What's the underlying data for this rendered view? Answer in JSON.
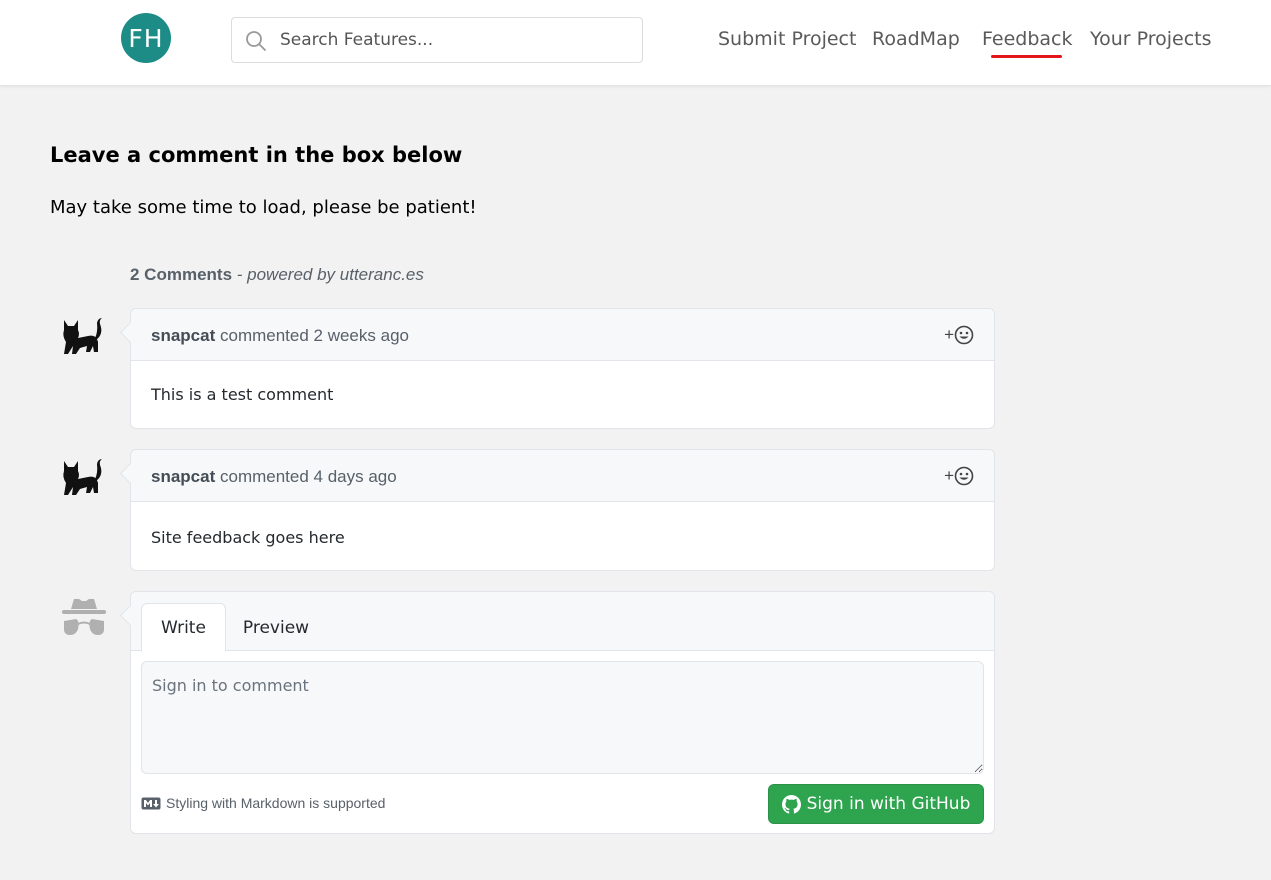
{
  "header": {
    "logo_text": "FH",
    "search_placeholder": "Search Features...",
    "nav": [
      {
        "label": "Submit Project"
      },
      {
        "label": "RoadMap"
      },
      {
        "label": "Feedback",
        "active": true
      },
      {
        "label": "Your Projects"
      }
    ]
  },
  "main": {
    "heading": "Leave a comment in the box below",
    "subtext": "May take some time to load, please be patient!"
  },
  "comments_widget": {
    "count_label": "2 Comments",
    "powered_by": "- powered by utteranc.es",
    "comments": [
      {
        "author": "snapcat",
        "meta": "commented 2 weeks ago",
        "body": "This is a test comment",
        "reaction_plus": "+",
        "avatar_icon": "black-cat-icon"
      },
      {
        "author": "snapcat",
        "meta": "commented 4 days ago",
        "body": "Site feedback goes here",
        "reaction_plus": "+",
        "avatar_icon": "black-cat-icon"
      }
    ],
    "editor": {
      "tab_write": "Write",
      "tab_preview": "Preview",
      "placeholder": "Sign in to comment",
      "markdown_note": "Styling with Markdown is supported",
      "sign_in_label": "Sign in with GitHub",
      "anon_avatar_icon": "incognito-icon"
    }
  },
  "colors": {
    "brand": "#1e8c86",
    "active_nav_underline": "#e3151a",
    "github_button": "#2ea44f"
  }
}
